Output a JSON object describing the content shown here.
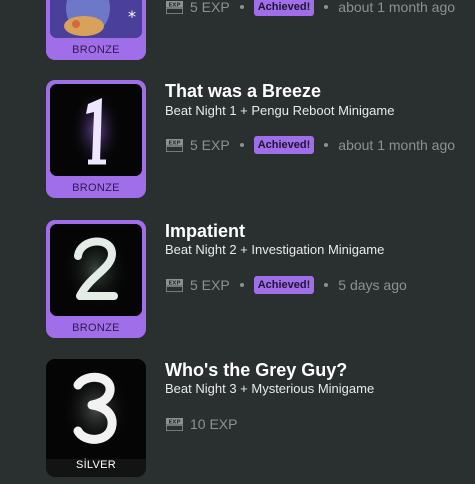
{
  "achievements": [
    {
      "title": "",
      "description": "",
      "tier": "BRONZE",
      "exp": "5 EXP",
      "status": "Achieved!",
      "time": "about 1 month ago",
      "art_icon": "cartoon-character-icon"
    },
    {
      "title": "That was a Breeze",
      "description": "Beat Night 1 + Pengu Reboot Minigame",
      "tier": "BRONZE",
      "exp": "5 EXP",
      "status": "Achieved!",
      "time": "about 1 month ago",
      "art_icon": "number-1-icon"
    },
    {
      "title": "Impatient",
      "description": "Beat Night 2 + Investigation Minigame",
      "tier": "BRONZE",
      "exp": "5 EXP",
      "status": "Achieved!",
      "time": "5 days ago",
      "art_icon": "number-2-icon"
    },
    {
      "title": "Who's the Grey Guy?",
      "description": "Beat Night 3 + Mysterious Minigame",
      "tier": "SİLVER",
      "exp": "10 EXP",
      "status": "",
      "time": "",
      "art_icon": "number-3-icon"
    }
  ],
  "colors": {
    "background": "#2a2f2f",
    "bronze": "#a16ee9",
    "achieved_pill": "#a16ee9",
    "muted_text": "#8b9292"
  }
}
